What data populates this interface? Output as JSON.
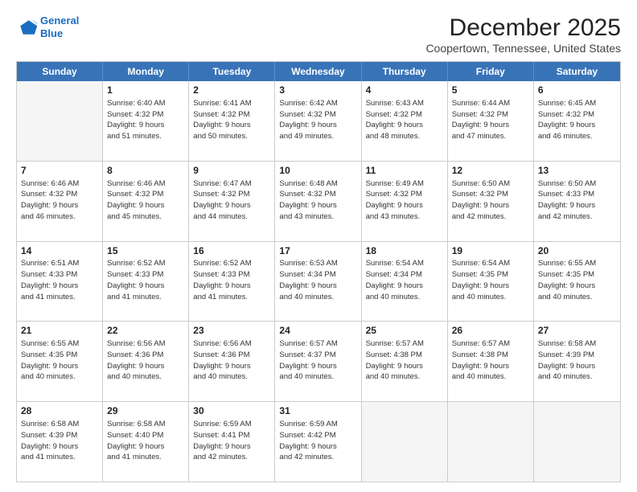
{
  "logo": {
    "line1": "General",
    "line2": "Blue"
  },
  "title": "December 2025",
  "subtitle": "Coopertown, Tennessee, United States",
  "header_days": [
    "Sunday",
    "Monday",
    "Tuesday",
    "Wednesday",
    "Thursday",
    "Friday",
    "Saturday"
  ],
  "weeks": [
    [
      {
        "day": "",
        "info": ""
      },
      {
        "day": "1",
        "info": "Sunrise: 6:40 AM\nSunset: 4:32 PM\nDaylight: 9 hours\nand 51 minutes."
      },
      {
        "day": "2",
        "info": "Sunrise: 6:41 AM\nSunset: 4:32 PM\nDaylight: 9 hours\nand 50 minutes."
      },
      {
        "day": "3",
        "info": "Sunrise: 6:42 AM\nSunset: 4:32 PM\nDaylight: 9 hours\nand 49 minutes."
      },
      {
        "day": "4",
        "info": "Sunrise: 6:43 AM\nSunset: 4:32 PM\nDaylight: 9 hours\nand 48 minutes."
      },
      {
        "day": "5",
        "info": "Sunrise: 6:44 AM\nSunset: 4:32 PM\nDaylight: 9 hours\nand 47 minutes."
      },
      {
        "day": "6",
        "info": "Sunrise: 6:45 AM\nSunset: 4:32 PM\nDaylight: 9 hours\nand 46 minutes."
      }
    ],
    [
      {
        "day": "7",
        "info": "Sunrise: 6:46 AM\nSunset: 4:32 PM\nDaylight: 9 hours\nand 46 minutes."
      },
      {
        "day": "8",
        "info": "Sunrise: 6:46 AM\nSunset: 4:32 PM\nDaylight: 9 hours\nand 45 minutes."
      },
      {
        "day": "9",
        "info": "Sunrise: 6:47 AM\nSunset: 4:32 PM\nDaylight: 9 hours\nand 44 minutes."
      },
      {
        "day": "10",
        "info": "Sunrise: 6:48 AM\nSunset: 4:32 PM\nDaylight: 9 hours\nand 43 minutes."
      },
      {
        "day": "11",
        "info": "Sunrise: 6:49 AM\nSunset: 4:32 PM\nDaylight: 9 hours\nand 43 minutes."
      },
      {
        "day": "12",
        "info": "Sunrise: 6:50 AM\nSunset: 4:32 PM\nDaylight: 9 hours\nand 42 minutes."
      },
      {
        "day": "13",
        "info": "Sunrise: 6:50 AM\nSunset: 4:33 PM\nDaylight: 9 hours\nand 42 minutes."
      }
    ],
    [
      {
        "day": "14",
        "info": "Sunrise: 6:51 AM\nSunset: 4:33 PM\nDaylight: 9 hours\nand 41 minutes."
      },
      {
        "day": "15",
        "info": "Sunrise: 6:52 AM\nSunset: 4:33 PM\nDaylight: 9 hours\nand 41 minutes."
      },
      {
        "day": "16",
        "info": "Sunrise: 6:52 AM\nSunset: 4:33 PM\nDaylight: 9 hours\nand 41 minutes."
      },
      {
        "day": "17",
        "info": "Sunrise: 6:53 AM\nSunset: 4:34 PM\nDaylight: 9 hours\nand 40 minutes."
      },
      {
        "day": "18",
        "info": "Sunrise: 6:54 AM\nSunset: 4:34 PM\nDaylight: 9 hours\nand 40 minutes."
      },
      {
        "day": "19",
        "info": "Sunrise: 6:54 AM\nSunset: 4:35 PM\nDaylight: 9 hours\nand 40 minutes."
      },
      {
        "day": "20",
        "info": "Sunrise: 6:55 AM\nSunset: 4:35 PM\nDaylight: 9 hours\nand 40 minutes."
      }
    ],
    [
      {
        "day": "21",
        "info": "Sunrise: 6:55 AM\nSunset: 4:35 PM\nDaylight: 9 hours\nand 40 minutes."
      },
      {
        "day": "22",
        "info": "Sunrise: 6:56 AM\nSunset: 4:36 PM\nDaylight: 9 hours\nand 40 minutes."
      },
      {
        "day": "23",
        "info": "Sunrise: 6:56 AM\nSunset: 4:36 PM\nDaylight: 9 hours\nand 40 minutes."
      },
      {
        "day": "24",
        "info": "Sunrise: 6:57 AM\nSunset: 4:37 PM\nDaylight: 9 hours\nand 40 minutes."
      },
      {
        "day": "25",
        "info": "Sunrise: 6:57 AM\nSunset: 4:38 PM\nDaylight: 9 hours\nand 40 minutes."
      },
      {
        "day": "26",
        "info": "Sunrise: 6:57 AM\nSunset: 4:38 PM\nDaylight: 9 hours\nand 40 minutes."
      },
      {
        "day": "27",
        "info": "Sunrise: 6:58 AM\nSunset: 4:39 PM\nDaylight: 9 hours\nand 40 minutes."
      }
    ],
    [
      {
        "day": "28",
        "info": "Sunrise: 6:58 AM\nSunset: 4:39 PM\nDaylight: 9 hours\nand 41 minutes."
      },
      {
        "day": "29",
        "info": "Sunrise: 6:58 AM\nSunset: 4:40 PM\nDaylight: 9 hours\nand 41 minutes."
      },
      {
        "day": "30",
        "info": "Sunrise: 6:59 AM\nSunset: 4:41 PM\nDaylight: 9 hours\nand 42 minutes."
      },
      {
        "day": "31",
        "info": "Sunrise: 6:59 AM\nSunset: 4:42 PM\nDaylight: 9 hours\nand 42 minutes."
      },
      {
        "day": "",
        "info": ""
      },
      {
        "day": "",
        "info": ""
      },
      {
        "day": "",
        "info": ""
      }
    ]
  ]
}
